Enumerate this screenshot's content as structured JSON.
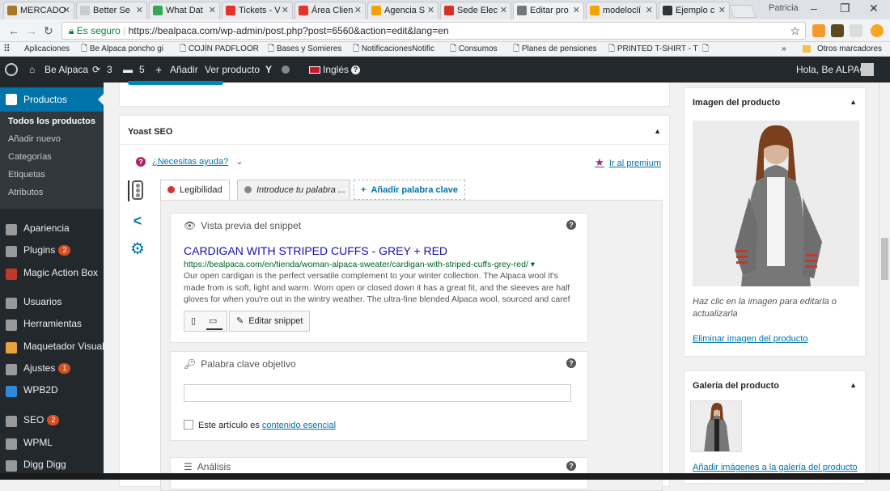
{
  "browser": {
    "tabs": [
      {
        "label": "MERCADO",
        "fav": "#a6782b"
      },
      {
        "label": "Better Se",
        "fav": "#cccccc"
      },
      {
        "label": "What Dat",
        "fav": "#34a853"
      },
      {
        "label": "Tickets - V",
        "fav": "#e6332a"
      },
      {
        "label": "Área Clien",
        "fav": "#e6332a"
      },
      {
        "label": "Agencia S",
        "fav": "#f4a300"
      },
      {
        "label": "Sede Elec",
        "fav": "#d93025"
      },
      {
        "label": "Editar pro",
        "fav": "#777777"
      },
      {
        "label": "modeloclí",
        "fav": "#f4a300"
      },
      {
        "label": "Ejemplo c",
        "fav": "#333333"
      }
    ],
    "profile": "Patricia",
    "secure_label": "Es seguro",
    "url": "https://bealpaca.com/wp-admin/post.php?post=6560&action=edit&lang=en",
    "bookmarks": [
      "Aplicaciones",
      "Be Alpaca poncho gi",
      "COJÍN PADFLOOR",
      "Bases y Somieres",
      "NotificacionesNotific",
      "Consumos",
      "Planes de pensiones",
      "PRINTED T-SHIRT - T",
      ""
    ],
    "other_bookmarks": "Otros marcadores"
  },
  "adminbar": {
    "site": "Be Alpaca",
    "updates": "3",
    "comments": "5",
    "add": "Añadir",
    "view": "Ver producto",
    "lang": "Inglés",
    "greeting": "Hola, Be ALPACA"
  },
  "sidebar": {
    "active": "Productos",
    "submenu": [
      "Todos los productos",
      "Añadir nuevo",
      "Categorías",
      "Etiquetas",
      "Atributos"
    ],
    "items": [
      {
        "label": "Apariencia",
        "badge": ""
      },
      {
        "label": "Plugins",
        "badge": "2"
      },
      {
        "label": "Magic Action Box",
        "badge": ""
      },
      {
        "label": "Usuarios",
        "badge": ""
      },
      {
        "label": "Herramientas",
        "badge": ""
      },
      {
        "label": "Maquetador Visual",
        "badge": ""
      },
      {
        "label": "Ajustes",
        "badge": "1"
      },
      {
        "label": "WPB2D",
        "badge": ""
      },
      {
        "label": "SEO",
        "badge": "2"
      },
      {
        "label": "WPML",
        "badge": ""
      },
      {
        "label": "Digg Digg",
        "badge": ""
      }
    ]
  },
  "yoast": {
    "title": "Yoast SEO",
    "help": "¿Necesitas ayuda?",
    "premium": "Ir al premium",
    "tabs": {
      "readability": "Legibilidad",
      "keyword": "Introduce tu palabra ...",
      "add_keyword": "Añadir palabra clave"
    },
    "snippet": {
      "heading": "Vista previa del snippet",
      "title": "CARDIGAN WITH STRIPED CUFFS - GREY + RED",
      "url": "https://bealpaca.com/en/tienda/woman-alpaca-sweater/cardigan-with-striped-cuffs-grey-red/",
      "description": "Our open cardigan is the perfect versatile complement to your winter collection. The Alpaca wool it's made from is soft, light and warm. Worn open or closed down it has a great fit, and the sleeves are half gloves for when you're out in the wintry weather. The ultra-fine blended Alpaca wool, sourced and caref",
      "edit": "Editar snippet"
    },
    "focus": {
      "heading": "Palabra clave objetivo",
      "value": "",
      "cornerstone_text": "Este artículo es",
      "cornerstone_link": "contenido esencial"
    },
    "analysis": "Análisis"
  },
  "product_image": {
    "title": "Imagen del producto",
    "hint": "Haz clic en la imagen para editarla o actualizarla",
    "remove": "Eliminar imagen del producto"
  },
  "gallery": {
    "title": "Galería del producto",
    "add": "Añadir imágenes a la galería del producto"
  },
  "colors": {
    "wp_blue": "#0073aa",
    "admin_dark": "#23282d",
    "yoast_purple": "#a4286a",
    "snippet_title": "#1a0dab",
    "snippet_url": "#006621"
  }
}
